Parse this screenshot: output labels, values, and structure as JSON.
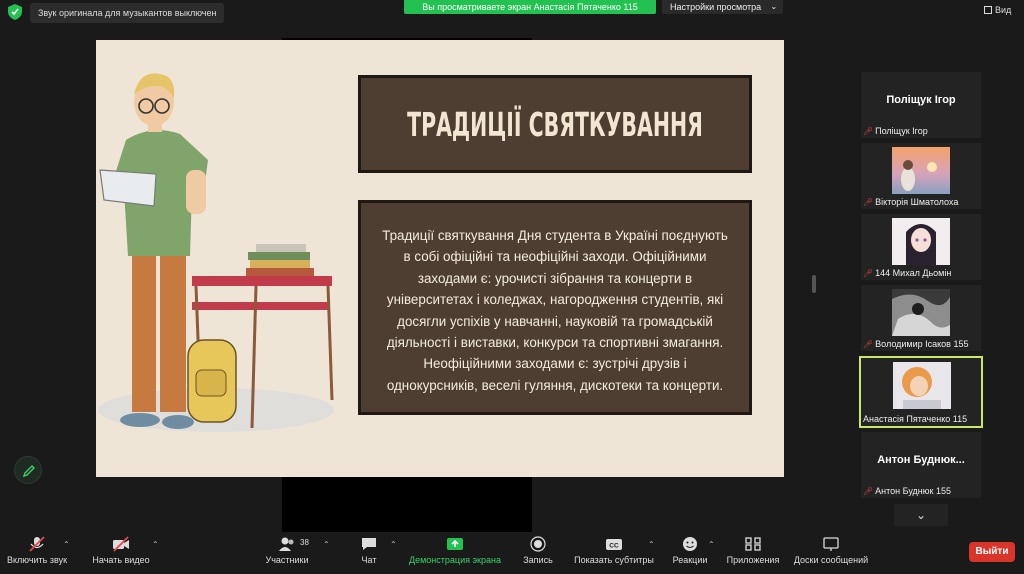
{
  "top_bar": {
    "original_sound_notice": "Звук оригинала для музыкантов выключен",
    "viewing_banner": "Вы просматриваете экран Анастасія Пятаченко 115",
    "view_settings": "Настройки просмотра",
    "view_button": "Вид"
  },
  "slide": {
    "title": "ТРАДИЦІЇ СВЯТКУВАННЯ",
    "body_lines": [
      "Традиції святкування Дня студента в Україні поєднують",
      "в собі офіційні та неофіційні заходи. Офіційними",
      "заходами є: урочисті зібрання та концерти в",
      "університетах і коледжах,  нагородження студентів, які",
      "досягли успіхів у навчанні, науковій та громадській",
      "діяльності і виставки, конкурси та спортивні змагання.",
      "Неофіційними заходами є: зустрічі друзів і",
      "однокурсників, веселі гуляння, дискотеки та концерти."
    ]
  },
  "participants": [
    {
      "display_name": "Поліщук Ігор",
      "label": "Поліщук Ігор",
      "has_photo": false,
      "active": false
    },
    {
      "display_name": "",
      "label": "Вікторія Шматолоха",
      "has_photo": true,
      "active": false
    },
    {
      "display_name": "",
      "label": "144 Михал Дьомін",
      "has_photo": true,
      "active": false
    },
    {
      "display_name": "",
      "label": "Володимир Ісаков 155",
      "has_photo": true,
      "active": false
    },
    {
      "display_name": "",
      "label": "Анастасія Пятаченко 115",
      "has_photo": true,
      "active": true
    },
    {
      "display_name": "Антон  Буднюк...",
      "label": "Антон Буднюк 155",
      "has_photo": false,
      "active": false
    }
  ],
  "toolbar": {
    "unmute": "Включить звук",
    "start_video": "Начать видео",
    "participants": "Участники",
    "participants_count": "38",
    "chat": "Чат",
    "share_screen": "Демонстрация экрана",
    "record": "Запись",
    "subtitles": "Показать субтитры",
    "reactions": "Реакции",
    "apps": "Приложения",
    "whiteboards": "Доски сообщений",
    "leave": "Выйти"
  },
  "colors": {
    "background": "#1a1a1a",
    "banner_green": "#23c152",
    "slide_bg": "#eee5d6",
    "slide_box": "#4e3e32",
    "slide_text": "#f4ecdf",
    "active_tile_border": "#c9e86a",
    "leave_red": "#d9352b"
  }
}
